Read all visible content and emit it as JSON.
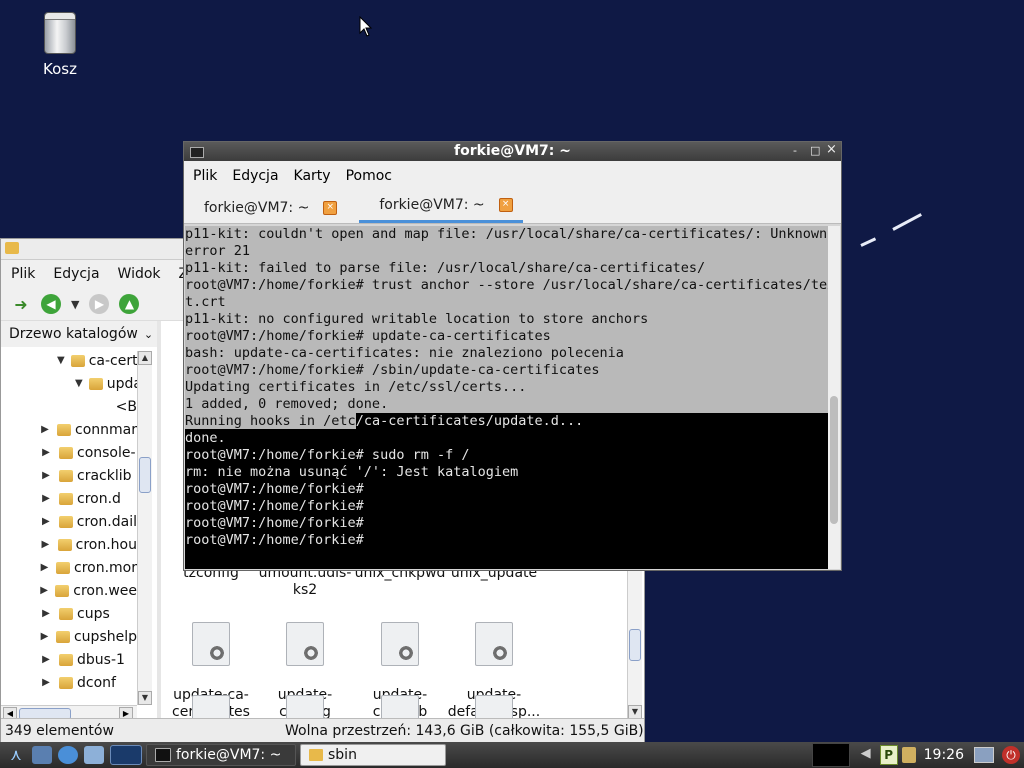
{
  "desktop": {
    "trash_label": "Kosz"
  },
  "file_manager": {
    "menu": [
      "Plik",
      "Edycja",
      "Widok",
      "Zak"
    ],
    "side_header": "Drzewo katalogów",
    "tree": [
      {
        "label": "ca-certifi",
        "indent": 1,
        "arrow": "▼"
      },
      {
        "label": "updat",
        "indent": 2,
        "arrow": "▼"
      },
      {
        "label": "<B",
        "indent": 4,
        "arrow": ""
      },
      {
        "label": "connmar",
        "indent": 0,
        "arrow": "▶"
      },
      {
        "label": "console-",
        "indent": 0,
        "arrow": "▶"
      },
      {
        "label": "cracklib",
        "indent": 0,
        "arrow": "▶"
      },
      {
        "label": "cron.d",
        "indent": 0,
        "arrow": "▶"
      },
      {
        "label": "cron.dail",
        "indent": 0,
        "arrow": "▶"
      },
      {
        "label": "cron.hou",
        "indent": 0,
        "arrow": "▶"
      },
      {
        "label": "cron.mor",
        "indent": 0,
        "arrow": "▶"
      },
      {
        "label": "cron.wee",
        "indent": 0,
        "arrow": "▶"
      },
      {
        "label": "cups",
        "indent": 0,
        "arrow": "▶"
      },
      {
        "label": "cupshelp",
        "indent": 0,
        "arrow": "▶"
      },
      {
        "label": "dbus-1",
        "indent": 0,
        "arrow": "▶"
      },
      {
        "label": "dconf",
        "indent": 0,
        "arrow": "▶"
      }
    ],
    "partial_files": [
      "tzconfig",
      "umount.udis-\nks2",
      "unix_chkpwd",
      "unix_update"
    ],
    "files": [
      {
        "label": "update-ca-\ncertificates"
      },
      {
        "label": "update-\ncatalog"
      },
      {
        "label": "update-\ncracklib"
      },
      {
        "label": "update-\ndefault-asp..."
      }
    ],
    "status_left": "349 elementów",
    "status_right": "Wolna przestrzeń: 143,6 GiB (całkowita: 155,5 GiB)"
  },
  "terminal": {
    "title": "forkie@VM7: ~",
    "window_controls": [
      "-",
      "□",
      "×"
    ],
    "menu": [
      "Plik",
      "Edycja",
      "Karty",
      "Pomoc"
    ],
    "tabs": [
      {
        "label": "forkie@VM7: ~",
        "close": "×"
      },
      {
        "label": "forkie@VM7: ~",
        "close": "×"
      }
    ],
    "lines": [
      "p11-kit: couldn't open and map file: /usr/local/share/ca-certificates/: Unknown",
      "error 21",
      "p11-kit: failed to parse file: /usr/local/share/ca-certificates/",
      "root@VM7:/home/forkie# trust anchor --store /usr/local/share/ca-certificates/tex",
      "t.crt",
      "p11-kit: no configured writable location to store anchors",
      "root@VM7:/home/forkie# update-ca-certificates",
      "bash: update-ca-certificates: nie znaleziono polecenia",
      "root@VM7:/home/forkie# /sbin/update-ca-certificates",
      "Updating certificates in /etc/ssl/certs...",
      "1 added, 0 removed; done.",
      "Running hooks in /etc",
      "done.",
      "root@VM7:/home/forkie# sudo rm -f /",
      "rm: nie można usunąć '/': Jest katalogiem",
      "root@VM7:/home/forkie#",
      "root@VM7:/home/forkie#",
      "root@VM7:/home/forkie#",
      "root@VM7:/home/forkie#"
    ],
    "partial_tail": "/ca-certificates/update.d...",
    "selected_line_count": 11
  },
  "taskbar": {
    "tasks": [
      {
        "label": "forkie@VM7: ~"
      },
      {
        "label": "sbin"
      }
    ],
    "clock": "19:26"
  }
}
